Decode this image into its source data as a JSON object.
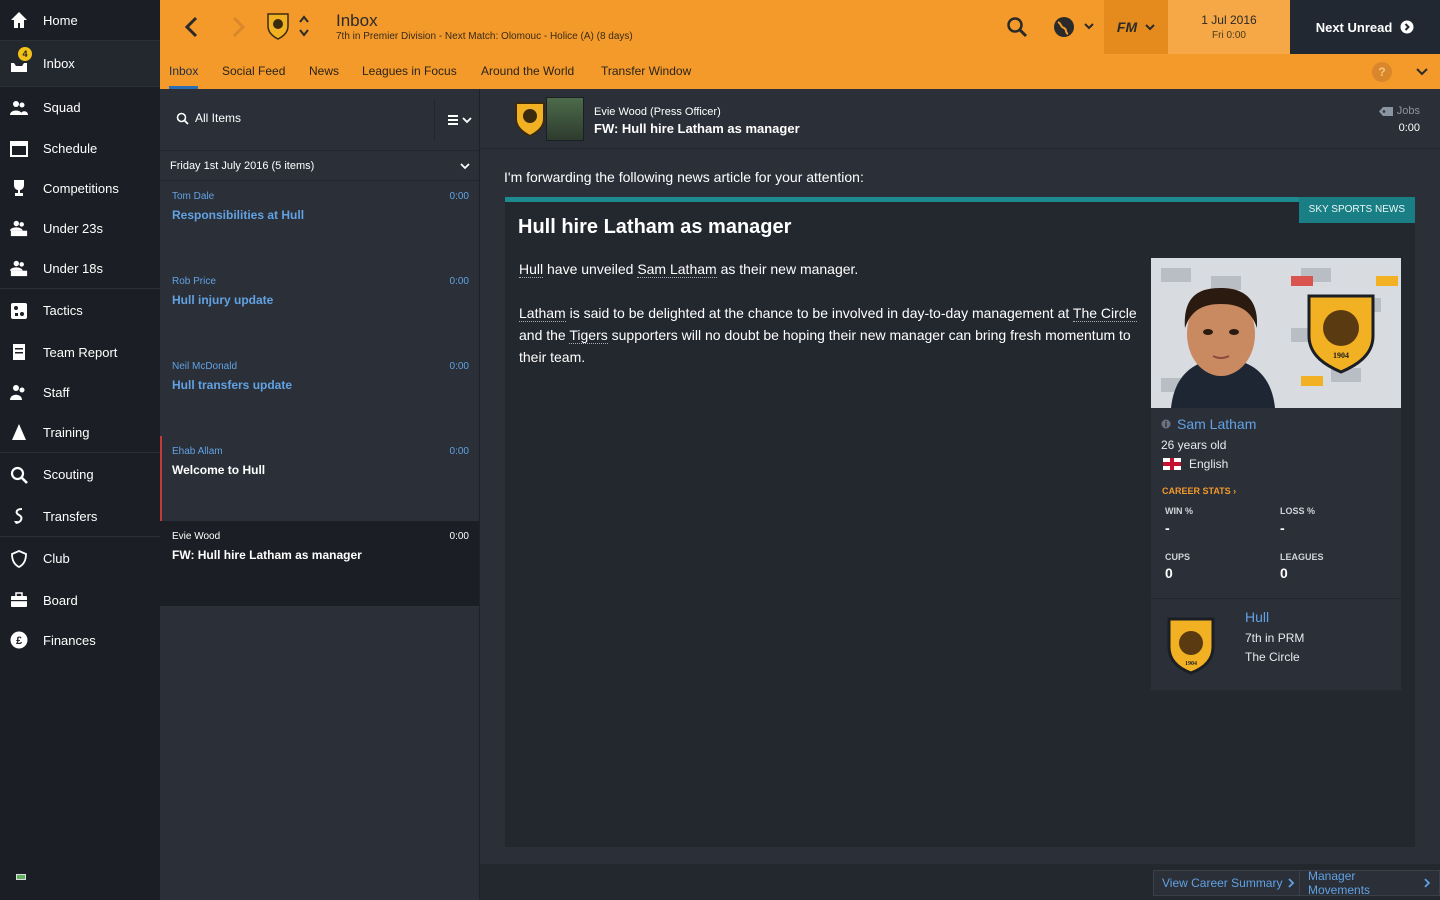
{
  "sidebar": {
    "items": [
      {
        "label": "Home",
        "icon": "home-icon"
      },
      {
        "label": "Inbox",
        "icon": "inbox-icon",
        "badge": "4"
      },
      {
        "label": "Squad",
        "icon": "squad-icon"
      },
      {
        "label": "Schedule",
        "icon": "calendar-icon"
      },
      {
        "label": "Competitions",
        "icon": "trophy-icon"
      },
      {
        "label": "Under 23s",
        "icon": "u23-icon"
      },
      {
        "label": "Under 18s",
        "icon": "u18-icon"
      },
      {
        "label": "Tactics",
        "icon": "tactics-icon"
      },
      {
        "label": "Team Report",
        "icon": "report-icon"
      },
      {
        "label": "Staff",
        "icon": "staff-icon"
      },
      {
        "label": "Training",
        "icon": "training-icon"
      },
      {
        "label": "Scouting",
        "icon": "search-icon"
      },
      {
        "label": "Transfers",
        "icon": "transfers-icon"
      },
      {
        "label": "Club",
        "icon": "shield-icon"
      },
      {
        "label": "Board",
        "icon": "briefcase-icon"
      },
      {
        "label": "Finances",
        "icon": "pound-icon"
      }
    ]
  },
  "header": {
    "title": "Inbox",
    "subtitle": "7th in Premier Division - Next Match: Olomouc - Holice (A) (8 days)",
    "fm_label": "FM",
    "date": "1 Jul 2016",
    "day_time": "Fri 0:00",
    "next_unread": "Next Unread"
  },
  "tabs": [
    "Inbox",
    "Social Feed",
    "News",
    "Leagues in Focus",
    "Around the World",
    "Transfer Window"
  ],
  "help_label": "?",
  "list": {
    "filter": "All Items",
    "group": "Friday 1st July 2016 (5 items)",
    "messages": [
      {
        "from": "Tom Dale",
        "subject": "Responsibilities at Hull",
        "time": "0:00"
      },
      {
        "from": "Rob Price",
        "subject": "Hull injury update",
        "time": "0:00"
      },
      {
        "from": "Neil McDonald",
        "subject": "Hull transfers update",
        "time": "0:00"
      },
      {
        "from": "Ehab Allam",
        "subject": "Welcome to Hull",
        "time": "0:00"
      },
      {
        "from": "Evie Wood",
        "subject": "FW: Hull hire Latham as manager",
        "time": "0:00"
      }
    ]
  },
  "message": {
    "from": "Evie Wood  (Press Officer)",
    "subject": "FW: Hull hire Latham as manager",
    "tag": "Jobs",
    "time": "0:00",
    "intro": "I'm forwarding the following news article for your attention:",
    "source": "SKY SPORTS NEWS",
    "headline": "Hull hire Latham as manager",
    "p1": {
      "a": "Hull",
      "b": " have unveiled ",
      "c": "Sam Latham",
      "d": " as their new manager."
    },
    "p2": {
      "a": "Latham",
      "b": " is said to be delighted at the chance to be involved in day-to-day management at ",
      "c": "The Circle",
      "d": " and the ",
      "e": "Tigers",
      "f": " supporters will no doubt be hoping their new manager can bring fresh momentum to their team."
    }
  },
  "person": {
    "name": "Sam Latham",
    "age": "26 years old",
    "nationality": "English",
    "career_label": "CAREER STATS",
    "win_label": "WIN %",
    "win": "-",
    "loss_label": "LOSS %",
    "loss": "-",
    "cups_label": "CUPS",
    "cups": "0",
    "leagues_label": "LEAGUES",
    "leagues": "0",
    "club": "Hull",
    "club_position": "7th in PRM",
    "stadium": "The Circle",
    "crest_year": "1904"
  },
  "footer": {
    "career_btn": "View Career Summary",
    "movements_btn": "Manager Movements"
  },
  "colors": {
    "accent": "#f39a2b",
    "link": "#62a2e3",
    "news_teal": "#1d8a8f",
    "sidebar_bg": "#1b1e24"
  }
}
